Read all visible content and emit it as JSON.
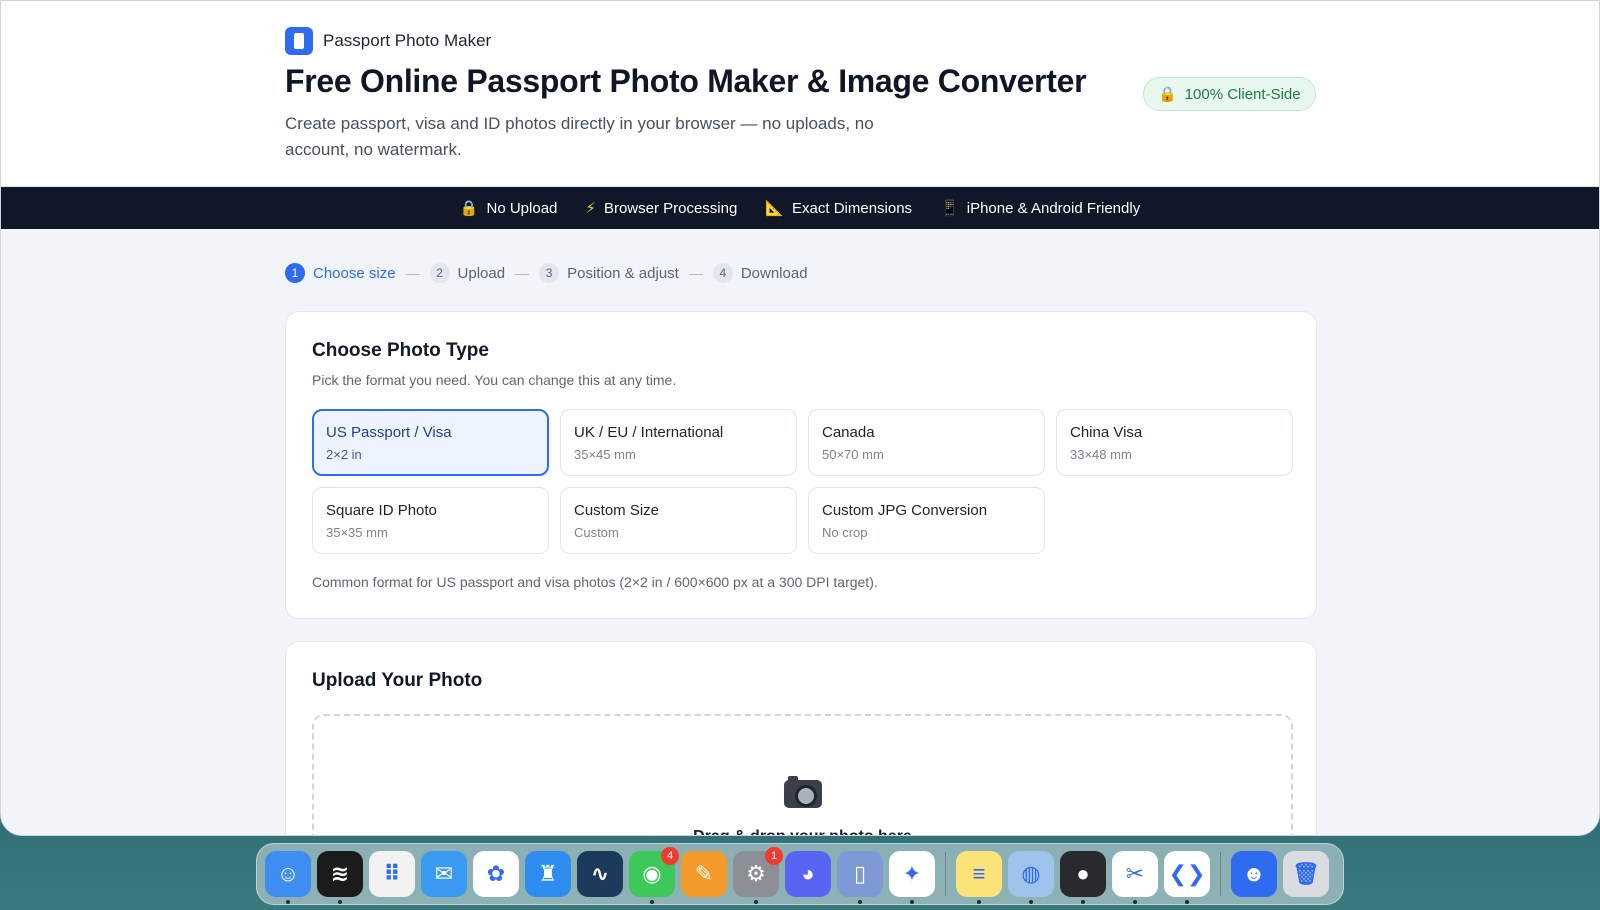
{
  "header": {
    "brand_name": "Passport Photo Maker",
    "title": "Free Online Passport Photo Maker & Image Converter",
    "subtitle": "Create passport, visa and ID photos directly in your browser — no uploads, no account, no watermark.",
    "badge": "100% Client-Side"
  },
  "features": [
    {
      "icon": "lock-icon",
      "glyph": "🔒",
      "label": "No Upload"
    },
    {
      "icon": "lightning-icon",
      "glyph": "⚡",
      "label": "Browser Processing"
    },
    {
      "icon": "ruler-triangle-icon",
      "glyph": "📐",
      "label": "Exact Dimensions"
    },
    {
      "icon": "phone-icon",
      "glyph": "📱",
      "label": "iPhone & Android Friendly"
    }
  ],
  "steps": [
    {
      "num": "1",
      "label": "Choose size",
      "active": true
    },
    {
      "num": "2",
      "label": "Upload",
      "active": false
    },
    {
      "num": "3",
      "label": "Position & adjust",
      "active": false
    },
    {
      "num": "4",
      "label": "Download",
      "active": false
    }
  ],
  "step_separator": "—",
  "photo_type": {
    "title": "Choose Photo Type",
    "subtitle": "Pick the format you need. You can change this at any time.",
    "options": [
      {
        "name": "US Passport / Visa",
        "size": "2×2 in",
        "selected": true
      },
      {
        "name": "UK / EU / International",
        "size": "35×45 mm",
        "selected": false
      },
      {
        "name": "Canada",
        "size": "50×70 mm",
        "selected": false
      },
      {
        "name": "China Visa",
        "size": "33×48 mm",
        "selected": false
      },
      {
        "name": "Square ID Photo",
        "size": "35×35 mm",
        "selected": false
      },
      {
        "name": "Custom Size",
        "size": "Custom",
        "selected": false
      },
      {
        "name": "Custom JPG Conversion",
        "size": "No crop",
        "selected": false
      }
    ],
    "note": "Common format for US passport and visa photos (2×2 in / 600×600 px at a 300 DPI target)."
  },
  "upload": {
    "title": "Upload Your Photo",
    "drop_text": "Drag & drop your photo here"
  },
  "dock": [
    {
      "name": "finder-icon",
      "color": "#3d8ef0",
      "glyph": "☺",
      "badge": "",
      "running": true
    },
    {
      "name": "spotify-icon",
      "color": "#1b1b1b",
      "glyph": "≋",
      "badge": "",
      "running": true
    },
    {
      "name": "launchpad-icon",
      "color": "#f2f2f2",
      "glyph": "⠿",
      "badge": "",
      "running": false
    },
    {
      "name": "mail-icon",
      "color": "#3a9af2",
      "glyph": "✉",
      "badge": "",
      "running": false
    },
    {
      "name": "photos-icon",
      "color": "#ffffff",
      "glyph": "✿",
      "badge": "",
      "running": false
    },
    {
      "name": "keynote-icon",
      "color": "#2f8cf0",
      "glyph": "♜",
      "badge": "",
      "running": false
    },
    {
      "name": "freeform-icon",
      "color": "#1b3a5c",
      "glyph": "∿",
      "badge": "",
      "running": false
    },
    {
      "name": "messages-icon",
      "color": "#3cc95a",
      "glyph": "◉",
      "badge": "4",
      "running": true
    },
    {
      "name": "pages-icon",
      "color": "#f39a2a",
      "glyph": "✎",
      "badge": "",
      "running": false
    },
    {
      "name": "system-settings-icon",
      "color": "#8c8f96",
      "glyph": "⚙",
      "badge": "1",
      "running": true
    },
    {
      "name": "discord-icon",
      "color": "#5865f2",
      "glyph": "◕",
      "badge": "",
      "running": false
    },
    {
      "name": "simulator-icon",
      "color": "#7d9ad6",
      "glyph": "▯",
      "badge": "",
      "running": true
    },
    {
      "name": "safari-icon",
      "color": "#ffffff",
      "glyph": "✦",
      "badge": "",
      "running": true
    },
    {
      "name": "notes-icon",
      "color": "#fbe37a",
      "glyph": "≡",
      "badge": "",
      "running": true
    },
    {
      "name": "preview-icon",
      "color": "#9ec3ea",
      "glyph": "◍",
      "badge": "",
      "running": true
    },
    {
      "name": "screen-recorder-icon",
      "color": "#2a2a2e",
      "glyph": "●",
      "badge": "",
      "running": true
    },
    {
      "name": "capcut-icon",
      "color": "#ffffff",
      "glyph": "✂",
      "badge": "",
      "running": true
    },
    {
      "name": "vscode-icon",
      "color": "#ffffff",
      "glyph": "❮❯",
      "badge": "",
      "running": true
    },
    {
      "name": "contacts-icon",
      "color": "#2f6bf0",
      "glyph": "☻",
      "badge": "",
      "running": false
    },
    {
      "name": "trash-icon",
      "color": "#d9dde2",
      "glyph": "🗑",
      "badge": "",
      "running": false
    }
  ]
}
